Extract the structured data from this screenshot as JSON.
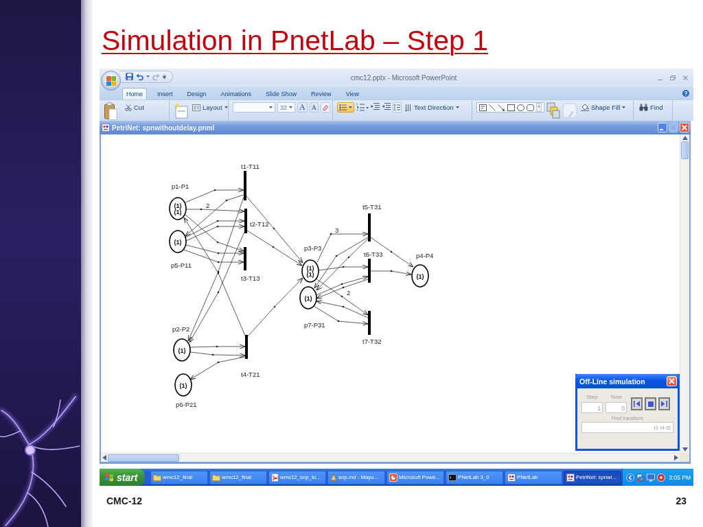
{
  "slide": {
    "title": "Simulation in PnetLab – Step 1",
    "footer": "CMC-12",
    "page_number": "23"
  },
  "powerpoint": {
    "title": "cmc12.pptx - Microsoft PowerPoint",
    "tabs": [
      {
        "label": "Home",
        "selected": true
      },
      {
        "label": "Insert",
        "selected": false
      },
      {
        "label": "Design",
        "selected": false
      },
      {
        "label": "Animations",
        "selected": false
      },
      {
        "label": "Slide Show",
        "selected": false
      },
      {
        "label": "Review",
        "selected": false
      },
      {
        "label": "View",
        "selected": false
      }
    ],
    "ribbon": {
      "cut": "Cut",
      "layout": "Layout",
      "font_size": "32",
      "grow_font": "A",
      "shrink_font": "A",
      "bullets": {
        "on": true
      },
      "text_direction": "Text Direction",
      "shape_fill": "Shape Fill",
      "find": "Find"
    }
  },
  "petrinet": {
    "title": "PetriNet: spnwithoutdelay.pnml",
    "places": [
      {
        "label": "p1-P1",
        "tokens": [
          "(1)",
          "(1)"
        ]
      },
      {
        "label": "p5-P11",
        "tokens": [
          "(1)"
        ]
      },
      {
        "label": "p2-P2",
        "tokens": [
          "(1)"
        ]
      },
      {
        "label": "p6-P21",
        "tokens": [
          "(1)"
        ]
      },
      {
        "label": "p3-P3",
        "tokens": [
          "(1)",
          "(1)"
        ]
      },
      {
        "label": "p7-P31",
        "tokens": [
          "(1)"
        ]
      },
      {
        "label": "p4-P4",
        "tokens": [
          "(1)"
        ]
      }
    ],
    "transitions": [
      {
        "label": "t1-T11"
      },
      {
        "label": "t2-T12"
      },
      {
        "label": "t3-T13"
      },
      {
        "label": "t4-T21"
      },
      {
        "label": "t5-T31"
      },
      {
        "label": "t6-T33"
      },
      {
        "label": "t7-T32"
      }
    ],
    "arc_weights": [
      "2",
      "3",
      "2"
    ]
  },
  "simulation": {
    "title": "Off-Line simulation",
    "fields": [
      {
        "label": "Step",
        "value": "1",
        "disabled": true
      },
      {
        "label": "Time",
        "value": "0",
        "disabled": true
      }
    ],
    "fired_label": "Fired transitions",
    "fired": {
      "value": "t1 t4 t5",
      "disabled": true
    }
  },
  "taskbar": {
    "start": "start",
    "items": [
      {
        "label": "wmc12_final",
        "kind": "folder",
        "selected": false
      },
      {
        "label": "wmc12_final",
        "kind": "folder",
        "selected": false
      },
      {
        "label": "wmc12_snp_to...",
        "kind": "pdf",
        "selected": false
      },
      {
        "label": "snp.md - Mayu...",
        "kind": "cone",
        "selected": false
      },
      {
        "label": "Microsoft Powe...",
        "kind": "slides",
        "selected": false
      },
      {
        "label": "PNetLab 3_0",
        "kind": "console",
        "selected": false
      },
      {
        "label": "PNetLab",
        "kind": "app",
        "selected": false
      },
      {
        "label": "PetriNet: spnwi...",
        "kind": "app",
        "selected": true
      }
    ],
    "clock": "3:05 PM"
  }
}
